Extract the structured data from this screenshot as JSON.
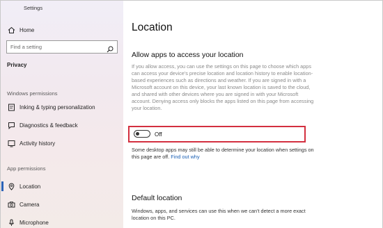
{
  "window": {
    "title": "Settings"
  },
  "sidebar": {
    "home_label": "Home",
    "search_placeholder": "Find a setting",
    "category": "Privacy",
    "windows_permissions_header": "Windows permissions",
    "windows_items": [
      {
        "label": "Inking & typing personalization",
        "icon": "inking-icon"
      },
      {
        "label": "Diagnostics & feedback",
        "icon": "diagnostics-icon"
      },
      {
        "label": "Activity history",
        "icon": "activity-history-icon"
      }
    ],
    "app_permissions_header": "App permissions",
    "app_items": [
      {
        "label": "Location",
        "icon": "location-icon",
        "selected": true
      },
      {
        "label": "Camera",
        "icon": "camera-icon"
      },
      {
        "label": "Microphone",
        "icon": "microphone-icon"
      }
    ]
  },
  "main": {
    "title": "Location",
    "allow_heading": "Allow apps to access your location",
    "allow_description": "If you allow access, you can use the settings on this page to choose which apps can access your device's precise location and location history to enable location-based experiences such as directions and weather. If you are signed in with a Microsoft account on this device, your last known location is saved to the cloud, and shared with other devices where you are signed in with your Microsoft account. Denying access only blocks the apps listed on this page from accessing your location.",
    "toggle_state": "Off",
    "desktop_note": "Some desktop apps may still be able to determine your location when settings on this page are off.",
    "find_out_why": "Find out why",
    "default_heading": "Default location",
    "default_description": "Windows, apps, and services can use this when we can't detect a more exact location on this PC."
  },
  "colors": {
    "accent": "#2b63b8",
    "highlight_frame": "#d32f3f",
    "link": "#1a5fb4"
  }
}
